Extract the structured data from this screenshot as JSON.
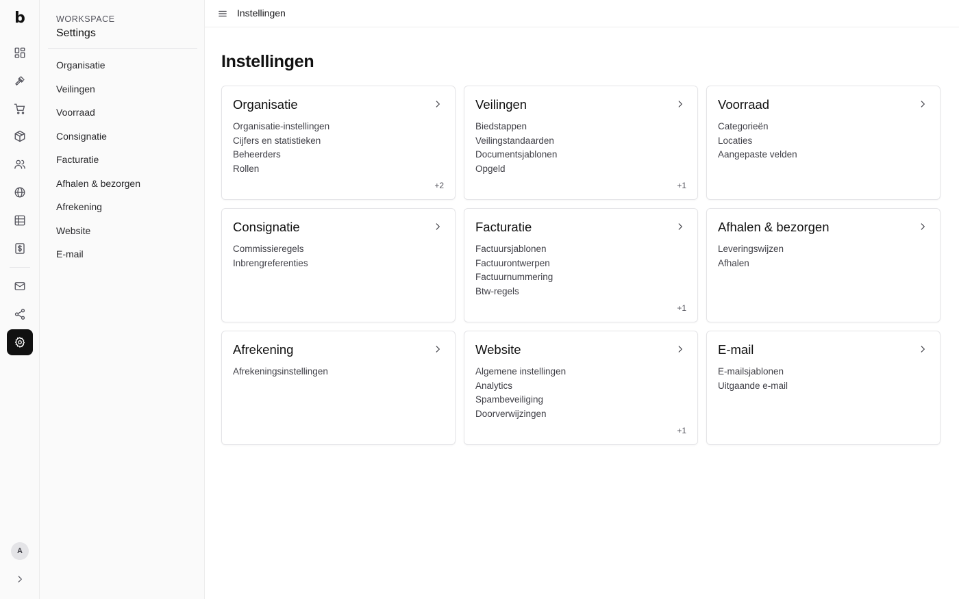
{
  "app": {
    "logo": "b",
    "avatar_initial": "A"
  },
  "workspace": {
    "label": "WORKSPACE",
    "title": "Settings"
  },
  "nav": [
    {
      "label": "Organisatie"
    },
    {
      "label": "Veilingen"
    },
    {
      "label": "Voorraad"
    },
    {
      "label": "Consignatie"
    },
    {
      "label": "Facturatie"
    },
    {
      "label": "Afhalen & bezorgen"
    },
    {
      "label": "Afrekening"
    },
    {
      "label": "Website"
    },
    {
      "label": "E-mail"
    }
  ],
  "rail_icons": [
    "dashboard-icon",
    "gavel-icon",
    "cart-icon",
    "package-icon",
    "users-icon",
    "globe-icon",
    "table-icon",
    "invoice-icon",
    "mail-icon",
    "share-icon",
    "gear-icon"
  ],
  "topbar": {
    "title": "Instellingen"
  },
  "page": {
    "title": "Instellingen"
  },
  "cards": [
    {
      "title": "Organisatie",
      "items": [
        "Organisatie-instellingen",
        "Cijfers en statistieken",
        "Beheerders",
        "Rollen"
      ],
      "more": "+2"
    },
    {
      "title": "Veilingen",
      "items": [
        "Biedstappen",
        "Veilingstandaarden",
        "Documentsjablonen",
        "Opgeld"
      ],
      "more": "+1"
    },
    {
      "title": "Voorraad",
      "items": [
        "Categorieën",
        "Locaties",
        "Aangepaste velden"
      ],
      "more": ""
    },
    {
      "title": "Consignatie",
      "items": [
        "Commissieregels",
        "Inbrengreferenties"
      ],
      "more": ""
    },
    {
      "title": "Facturatie",
      "items": [
        "Factuursjablonen",
        "Factuurontwerpen",
        "Factuurnummering",
        "Btw-regels"
      ],
      "more": "+1"
    },
    {
      "title": "Afhalen & bezorgen",
      "items": [
        "Leveringswijzen",
        "Afhalen"
      ],
      "more": ""
    },
    {
      "title": "Afrekening",
      "items": [
        "Afrekeningsinstellingen"
      ],
      "more": ""
    },
    {
      "title": "Website",
      "items": [
        "Algemene instellingen",
        "Analytics",
        "Spambeveiliging",
        "Doorverwijzingen"
      ],
      "more": "+1"
    },
    {
      "title": "E-mail",
      "items": [
        "E-mailsjablonen",
        "Uitgaande e-mail"
      ],
      "more": ""
    }
  ],
  "colors": {
    "active_rail": "#111111",
    "border": "#e4e4e7",
    "sidebar_bg": "#fafafa"
  }
}
